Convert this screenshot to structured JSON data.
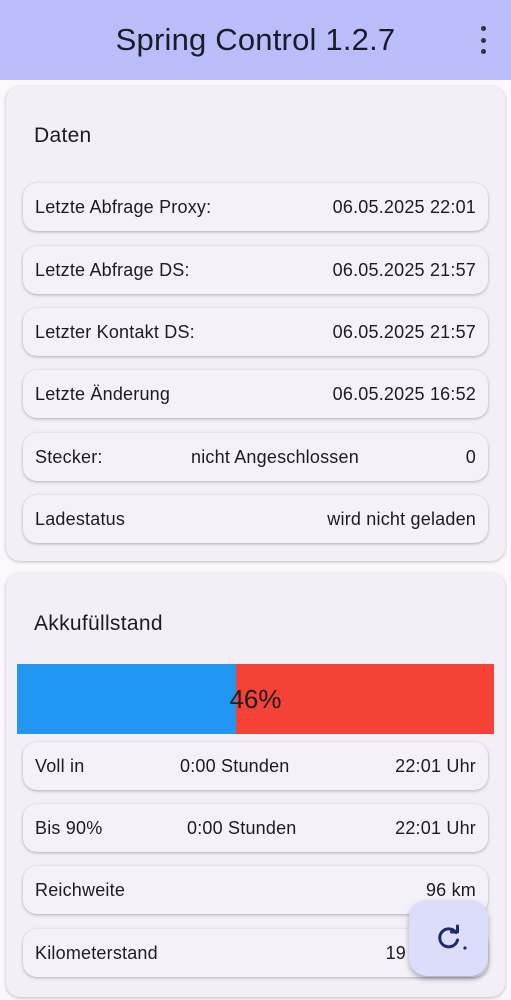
{
  "appbar": {
    "title": "Spring Control 1.2.7",
    "menu_icon": "more-vert-icon"
  },
  "daten": {
    "title": "Daten",
    "rows": [
      {
        "label": "Letzte Abfrage Proxy:",
        "value": "06.05.2025 22:01"
      },
      {
        "label": "Letzte Abfrage DS:",
        "value": "06.05.2025 21:57"
      },
      {
        "label": "Letzter Kontakt DS:",
        "value": "06.05.2025 21:57"
      },
      {
        "label": "Letzte Änderung",
        "value": "06.05.2025 16:52"
      },
      {
        "label": "Stecker:",
        "middle": "nicht Angeschlossen",
        "value": "0"
      },
      {
        "label": "Ladestatus",
        "value": "wird nicht geladen"
      }
    ]
  },
  "akku": {
    "title": "Akkufüllstand",
    "level_percent": 46,
    "level_label": "46%",
    "fill_color": "#2196f3",
    "empty_color": "#f44336",
    "rows": [
      {
        "label": "Voll in",
        "middle": "0:00 Stunden",
        "value": "22:01 Uhr"
      },
      {
        "label": "Bis 90%",
        "middle": "0:00 Stunden",
        "value": "22:01 Uhr"
      },
      {
        "label": "Reichweite",
        "value": "96 km"
      },
      {
        "label": "Kilometerstand",
        "value": "19"
      }
    ]
  },
  "fab": {
    "icon": "refresh-icon"
  },
  "colors": {
    "appbar": "#b9bdfa",
    "card": "#f3eff6",
    "fab": "#dcdcfb"
  }
}
